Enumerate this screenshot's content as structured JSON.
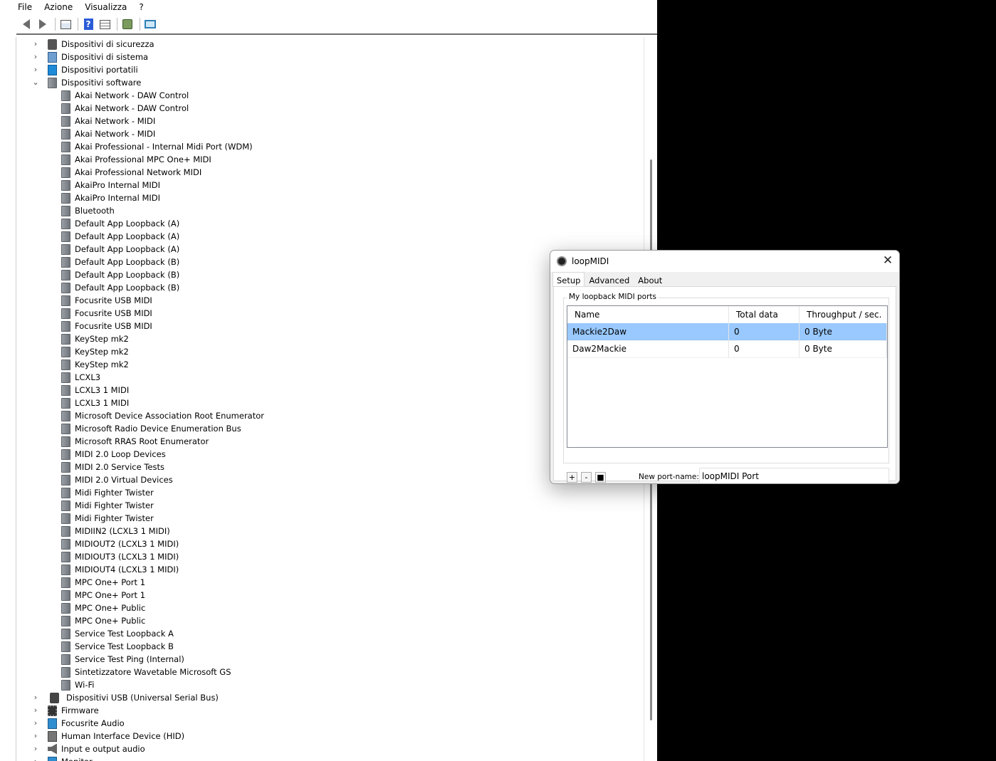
{
  "menubar": {
    "items": [
      "File",
      "Azione",
      "Visualizza",
      "?"
    ]
  },
  "toolbar": {
    "buttons": [
      "back-icon",
      "forward-icon",
      "show-hide-console-tree-icon",
      "help-icon",
      "properties-icon",
      "update-driver-icon",
      "monitor-icon"
    ]
  },
  "tree": {
    "categories_top": [
      {
        "label": "Dispositivi di sicurezza",
        "icon": "security-icon",
        "expanded": false
      },
      {
        "label": "Dispositivi di sistema",
        "icon": "system-icon",
        "expanded": false
      },
      {
        "label": "Dispositivi portatili",
        "icon": "portable-icon",
        "expanded": false
      },
      {
        "label": "Dispositivi software",
        "icon": "software-device-icon",
        "expanded": true
      }
    ],
    "software_devices": [
      "Akai Network - DAW Control",
      "Akai Network - DAW Control",
      "Akai Network - MIDI",
      "Akai Network - MIDI",
      "Akai Professional - Internal Midi Port (WDM)",
      "Akai Professional MPC One+ MIDI",
      "Akai Professional Network MIDI",
      "AkaiPro Internal MIDI",
      "AkaiPro Internal MIDI",
      "Bluetooth",
      "Default App Loopback (A)",
      "Default App Loopback (A)",
      "Default App Loopback (A)",
      "Default App Loopback (B)",
      "Default App Loopback (B)",
      "Default App Loopback (B)",
      "Focusrite USB MIDI",
      "Focusrite USB MIDI",
      "Focusrite USB MIDI",
      "KeyStep mk2",
      "KeyStep mk2",
      "KeyStep mk2",
      "LCXL3",
      "LCXL3 1 MIDI",
      "LCXL3 1 MIDI",
      "Microsoft Device Association Root Enumerator",
      "Microsoft Radio Device Enumeration Bus",
      "Microsoft RRAS Root Enumerator",
      "MIDI 2.0 Loop Devices",
      "MIDI 2.0 Service Tests",
      "MIDI 2.0 Virtual Devices",
      "Midi Fighter Twister",
      "Midi Fighter Twister",
      "Midi Fighter Twister",
      "MIDIIN2 (LCXL3 1 MIDI)",
      "MIDIOUT2 (LCXL3 1 MIDI)",
      "MIDIOUT3 (LCXL3 1 MIDI)",
      "MIDIOUT4 (LCXL3 1 MIDI)",
      "MPC One+ Port 1",
      "MPC One+ Port 1",
      "MPC One+ Public",
      "MPC One+ Public",
      "Service Test Loopback A",
      "Service Test Loopback B",
      "Service Test Ping (Internal)",
      "Sintetizzatore Wavetable Microsoft GS",
      "Wi-Fi"
    ],
    "categories_bottom": [
      {
        "label": "Dispositivi USB (Universal Serial Bus)",
        "icon": "usb-icon"
      },
      {
        "label": "Firmware",
        "icon": "firmware-icon"
      },
      {
        "label": "Focusrite Audio",
        "icon": "audio-icon"
      },
      {
        "label": "Human Interface Device (HID)",
        "icon": "hid-icon"
      },
      {
        "label": "Input e output audio",
        "icon": "speaker-icon"
      },
      {
        "label": "Monitor",
        "icon": "monitor-icon"
      }
    ]
  },
  "loopmidi": {
    "title": "loopMIDI",
    "tabs": [
      "Setup",
      "Advanced",
      "About"
    ],
    "active_tab": "Setup",
    "group_label": "My loopback MIDI ports",
    "columns": [
      "Name",
      "Total data",
      "Throughput / sec."
    ],
    "ports": [
      {
        "name": "Mackie2Daw",
        "total": "0",
        "throughput": "0 Byte",
        "selected": true
      },
      {
        "name": "Daw2Mackie",
        "total": "0",
        "throughput": "0 Byte",
        "selected": false
      }
    ],
    "buttons": {
      "add": "+",
      "remove": "-",
      "stop": "■"
    },
    "new_port_label": "New port-name:",
    "new_port_value": "loopMIDI Port"
  }
}
